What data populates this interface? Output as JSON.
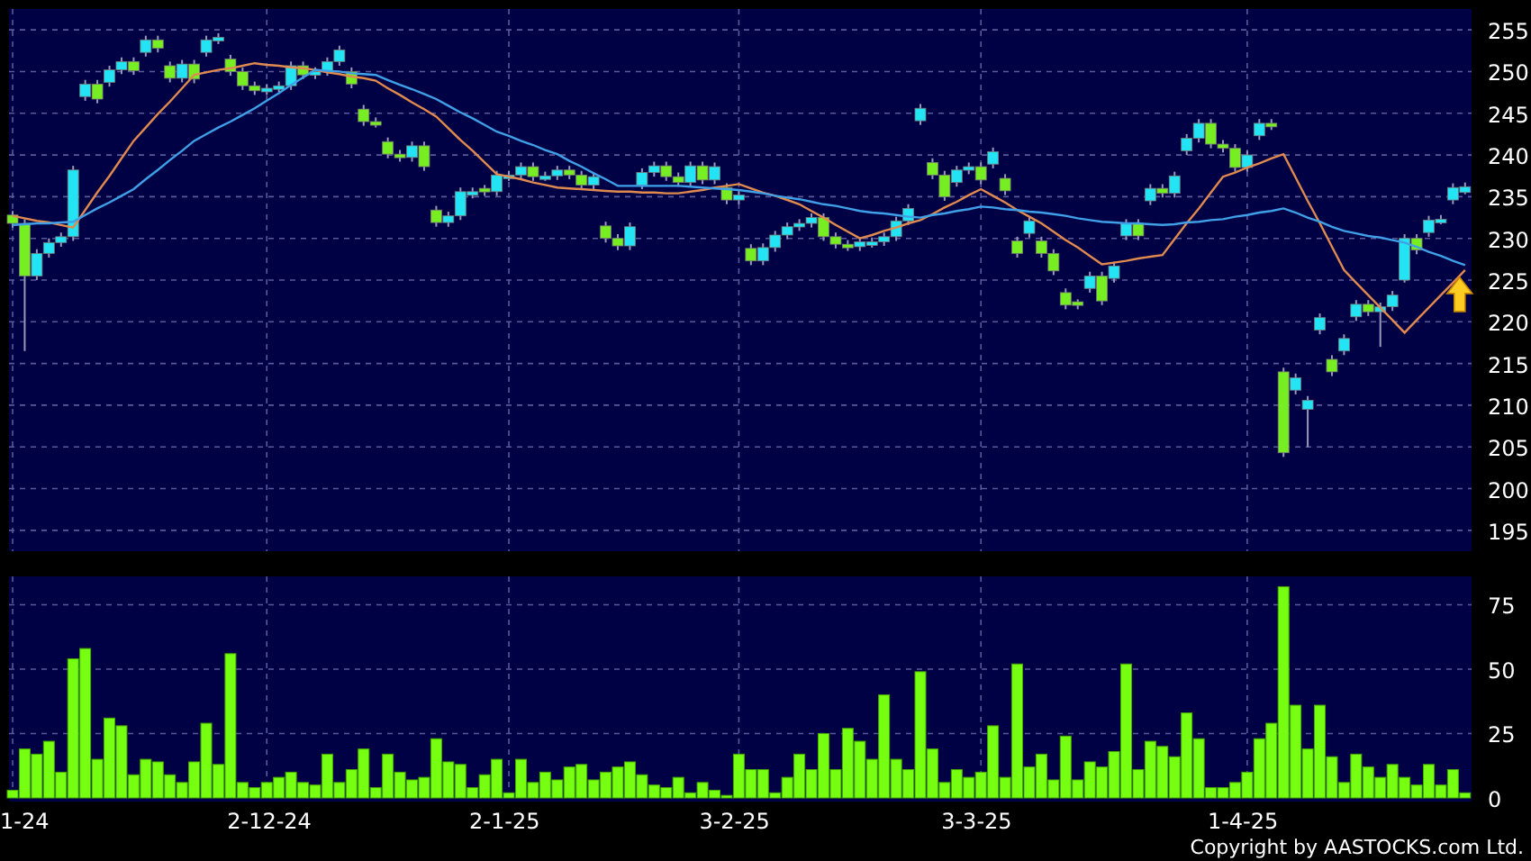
{
  "price_chart": {
    "chart_data": {
      "type": "candlestick",
      "grid": true,
      "ylim": [
        192.5,
        257.5
      ],
      "yticks": [
        195,
        200,
        205,
        210,
        215,
        220,
        225,
        230,
        235,
        240,
        245,
        250,
        255
      ],
      "ohlc": [
        [
          232.8,
          233.3,
          231.3,
          231.8
        ],
        [
          231.8,
          232.3,
          216.5,
          225.5
        ],
        [
          225.5,
          228.7,
          225,
          228.2
        ],
        [
          228.2,
          230,
          227.7,
          229.5
        ],
        [
          229.5,
          230.7,
          229,
          230.2
        ],
        [
          230.2,
          238.7,
          229.7,
          238.2
        ],
        [
          247,
          249,
          246.5,
          248.5
        ],
        [
          248.5,
          249,
          246.2,
          246.7
        ],
        [
          248.7,
          250.7,
          248.2,
          250.2
        ],
        [
          250.2,
          251.7,
          249.7,
          251.2
        ],
        [
          251.2,
          251.7,
          249.6,
          250.1
        ],
        [
          252.3,
          254.3,
          251.8,
          253.8
        ],
        [
          253.8,
          254.3,
          252.3,
          252.8
        ],
        [
          250.7,
          251.2,
          248.7,
          249.2
        ],
        [
          249.2,
          251.4,
          248.7,
          250.9
        ],
        [
          250.9,
          251.4,
          248.6,
          249.1
        ],
        [
          252.3,
          254.3,
          251.8,
          253.8
        ],
        [
          253.8,
          254.6,
          253.3,
          254.1
        ],
        [
          251.5,
          252,
          249.5,
          250
        ],
        [
          250,
          250.5,
          247.8,
          248.3
        ],
        [
          248.3,
          248.8,
          247.2,
          247.7
        ],
        [
          247.7,
          248.5,
          247.2,
          248
        ],
        [
          248,
          248.8,
          247.5,
          248.3
        ],
        [
          248.3,
          251.2,
          247.8,
          250.7
        ],
        [
          250.7,
          251.2,
          249.1,
          249.6
        ],
        [
          249.6,
          250.5,
          249.1,
          250
        ],
        [
          250,
          251.7,
          249.5,
          251.2
        ],
        [
          251.2,
          253.1,
          250.7,
          252.6
        ],
        [
          250,
          250.5,
          248,
          248.5
        ],
        [
          245.5,
          246,
          243.5,
          244
        ],
        [
          244,
          244.5,
          243.3,
          243.8
        ],
        [
          241.6,
          242.1,
          239.6,
          240.1
        ],
        [
          240.1,
          240.6,
          239.2,
          239.7
        ],
        [
          239.7,
          241.6,
          239.2,
          241.1
        ],
        [
          241.1,
          241.6,
          238.1,
          238.6
        ],
        [
          233.4,
          233.9,
          231.4,
          231.9
        ],
        [
          231.9,
          233.2,
          231.4,
          232.7
        ],
        [
          232.7,
          236.1,
          232.2,
          235.6
        ],
        [
          235.2,
          236.1,
          234.8,
          235.6
        ],
        [
          236,
          236.4,
          235.1,
          235.6
        ],
        [
          235.6,
          238.1,
          235.1,
          237.6
        ],
        [
          237.2,
          238.1,
          236.9,
          237.6
        ],
        [
          237.6,
          239.1,
          237.1,
          238.6
        ],
        [
          238.6,
          239.1,
          236.9,
          237.4
        ],
        [
          237.1,
          238,
          236.9,
          237.5
        ],
        [
          237.5,
          238.7,
          237,
          238.2
        ],
        [
          238.2,
          238.7,
          237.1,
          237.6
        ],
        [
          237.6,
          238.1,
          235.9,
          236.4
        ],
        [
          236.4,
          237.9,
          235.9,
          237.4
        ],
        [
          231.5,
          232,
          229.5,
          230
        ],
        [
          230,
          230.5,
          228.6,
          229.1
        ],
        [
          229.1,
          231.9,
          228.6,
          231.4
        ],
        [
          236.4,
          238.4,
          235.9,
          237.9
        ],
        [
          237.9,
          239.2,
          237.4,
          238.7
        ],
        [
          238.7,
          239.2,
          236.9,
          237.4
        ],
        [
          237.4,
          237.9,
          236.2,
          236.7
        ],
        [
          236.7,
          239.2,
          236.2,
          238.7
        ],
        [
          238.7,
          239.2,
          236.5,
          237
        ],
        [
          237,
          239.1,
          236.5,
          238.6
        ],
        [
          236.1,
          236.6,
          234.1,
          234.6
        ],
        [
          234.6,
          235.7,
          234.1,
          235.2
        ],
        [
          228.8,
          229.3,
          226.8,
          227.3
        ],
        [
          227.3,
          229.4,
          226.8,
          228.9
        ],
        [
          228.9,
          230.9,
          228.4,
          230.4
        ],
        [
          230.4,
          231.9,
          229.9,
          231.4
        ],
        [
          231.4,
          232.3,
          230.9,
          231.8
        ],
        [
          231.8,
          233,
          231.3,
          232.5
        ],
        [
          232.5,
          233,
          229.7,
          230.2
        ],
        [
          230.2,
          230.7,
          228.8,
          229.3
        ],
        [
          229.3,
          229.8,
          228.5,
          229
        ],
        [
          229,
          230.1,
          228.5,
          229.6
        ],
        [
          229.2,
          230.1,
          228.9,
          229.6
        ],
        [
          229.6,
          230.7,
          229.1,
          230.2
        ],
        [
          230.2,
          232.6,
          229.7,
          232.1
        ],
        [
          232.1,
          234.1,
          231.6,
          233.6
        ],
        [
          244.1,
          246.1,
          243.6,
          245.6
        ],
        [
          239.1,
          239.6,
          237.1,
          237.6
        ],
        [
          237.6,
          238.1,
          234.5,
          235
        ],
        [
          236.7,
          238.7,
          236.2,
          238.2
        ],
        [
          238.2,
          239.1,
          237.7,
          238.6
        ],
        [
          238.6,
          239.1,
          236.5,
          237
        ],
        [
          238.9,
          240.9,
          238.4,
          240.4
        ],
        [
          237.2,
          237.7,
          235.2,
          235.7
        ],
        [
          229.7,
          230.2,
          227.7,
          228.2
        ],
        [
          230.6,
          232.6,
          230.1,
          232.1
        ],
        [
          229.7,
          230.2,
          227.7,
          228.2
        ],
        [
          228.2,
          228.7,
          225.6,
          226.1
        ],
        [
          223.5,
          224,
          221.5,
          222
        ],
        [
          222.4,
          222.7,
          221.5,
          222
        ],
        [
          224,
          226,
          223.5,
          225.5
        ],
        [
          225.5,
          226,
          222,
          222.5
        ],
        [
          225.2,
          227.2,
          224.7,
          226.7
        ],
        [
          230.3,
          232.3,
          229.8,
          231.8
        ],
        [
          231.8,
          232.3,
          229.8,
          230.3
        ],
        [
          234.5,
          236.5,
          234,
          236
        ],
        [
          236,
          236.5,
          234.9,
          235.4
        ],
        [
          235.4,
          238,
          234.9,
          237.5
        ],
        [
          240.5,
          242.5,
          240,
          242
        ],
        [
          242,
          244.3,
          241.5,
          243.8
        ],
        [
          243.8,
          244.3,
          240.8,
          241.3
        ],
        [
          241.3,
          241.8,
          240.3,
          240.8
        ],
        [
          240.8,
          241.3,
          238,
          238.5
        ],
        [
          238.5,
          240.5,
          238,
          240
        ],
        [
          242.3,
          244.3,
          241.8,
          243.8
        ],
        [
          243.8,
          244.3,
          243,
          243.5
        ],
        [
          214,
          214.5,
          203.8,
          204.3
        ],
        [
          211.8,
          213.8,
          211.3,
          213.3
        ],
        [
          209.5,
          211.1,
          205,
          210.6
        ],
        [
          219,
          221,
          218.5,
          220.5
        ],
        [
          215.5,
          216,
          213.5,
          214
        ],
        [
          216.5,
          218.5,
          216,
          218
        ],
        [
          220.6,
          222.6,
          220.1,
          222.1
        ],
        [
          222.1,
          222.6,
          220.7,
          221.2
        ],
        [
          221.2,
          222.3,
          217,
          221.8
        ],
        [
          221.8,
          223.7,
          221.3,
          223.2
        ],
        [
          225,
          230.5,
          224.7,
          230
        ],
        [
          230,
          230.5,
          228.1,
          228.6
        ],
        [
          230.7,
          232.7,
          230.2,
          232.2
        ],
        [
          231.9,
          232.8,
          231.7,
          232.3
        ],
        [
          234.6,
          236.6,
          234.1,
          236.1
        ],
        [
          235.5,
          236.7,
          235.3,
          236.2
        ]
      ],
      "series": [
        {
          "type": "line",
          "color": "#e08a50",
          "values": [
            232.7,
            232.4,
            232.1,
            231.9,
            231.6,
            231.3,
            233.4,
            235.5,
            237.5,
            239.6,
            241.7,
            243.3,
            244.9,
            246.4,
            248,
            249.6,
            249.9,
            250.2,
            250.4,
            250.7,
            251,
            250.8,
            250.7,
            250.5,
            250.4,
            250.2,
            249.9,
            249.7,
            249.4,
            249.2,
            248.9,
            248,
            247.2,
            246.3,
            245.5,
            244.6,
            243.2,
            241.8,
            240.5,
            239.1,
            237.7,
            237.4,
            237.1,
            236.7,
            236.4,
            236.1,
            236,
            235.9,
            235.8,
            235.7,
            235.6,
            235.6,
            235.5,
            235.5,
            235.4,
            235.4,
            235.6,
            235.8,
            236.1,
            236.3,
            236.5,
            236,
            235.5,
            235.1,
            234.6,
            234.1,
            233.3,
            232.5,
            231.6,
            230.8,
            230,
            230.4,
            230.9,
            231.3,
            231.8,
            232.2,
            232.9,
            233.7,
            234.4,
            235.2,
            235.9,
            235.1,
            234.3,
            233.4,
            232.6,
            231.8,
            230.8,
            229.8,
            228.9,
            227.9,
            226.9,
            227.1,
            227.3,
            227.6,
            227.8,
            228,
            229.9,
            231.8,
            233.6,
            235.5,
            237.4,
            237.9,
            238.5,
            239,
            239.6,
            240.1,
            237.3,
            234.5,
            231.8,
            229,
            226.2,
            224.7,
            223.2,
            221.7,
            220.2,
            218.7,
            220.2,
            221.7,
            223.2,
            224.7,
            226.2
          ]
        },
        {
          "type": "line",
          "color": "#3fa0e8",
          "values": [
            231.6,
            231.7,
            231.8,
            231.8,
            231.9,
            232,
            232.8,
            233.6,
            234.3,
            235.1,
            235.9,
            237.1,
            238.2,
            239.4,
            240.5,
            241.7,
            242.5,
            243.3,
            244,
            244.8,
            245.6,
            246.5,
            247.4,
            248.4,
            249.3,
            250.2,
            250.1,
            250,
            249.8,
            249.7,
            249.6,
            249,
            248.4,
            247.9,
            247.3,
            246.7,
            245.9,
            245.1,
            244.4,
            243.6,
            242.8,
            242.3,
            241.7,
            241.2,
            240.6,
            240.1,
            239.3,
            238.6,
            237.8,
            237.1,
            236.3,
            236.3,
            236.3,
            236.3,
            236.3,
            236.3,
            236.2,
            236.1,
            236,
            235.9,
            235.8,
            235.6,
            235.4,
            235.1,
            234.9,
            234.7,
            234.4,
            234.1,
            233.9,
            233.6,
            233.3,
            233.1,
            233,
            232.8,
            232.6,
            232.5,
            232.8,
            233,
            233.3,
            233.5,
            233.8,
            233.7,
            233.5,
            233.4,
            233.2,
            233.1,
            232.9,
            232.7,
            232.4,
            232.2,
            232,
            231.9,
            231.8,
            231.8,
            231.7,
            231.6,
            231.7,
            231.9,
            232,
            232.2,
            232.3,
            232.6,
            232.8,
            233.1,
            233.3,
            233.6,
            233.1,
            232.5,
            232,
            231.4,
            230.9,
            230.6,
            230.3,
            230.1,
            229.8,
            229.5,
            229,
            228.4,
            227.9,
            227.3,
            226.8
          ]
        }
      ]
    }
  },
  "volume_chart": {
    "chart_data": {
      "type": "bar",
      "grid": true,
      "ylim": [
        0,
        86
      ],
      "yticks": [
        0,
        25,
        50,
        75
      ],
      "values": [
        3,
        19,
        17,
        22,
        10,
        54,
        58,
        15,
        31,
        28,
        9,
        15,
        14,
        9,
        6,
        14,
        29,
        13,
        56,
        6,
        4,
        6,
        8,
        10,
        6,
        5,
        17,
        6,
        11,
        19,
        4,
        17,
        10,
        7,
        8,
        23,
        14,
        13,
        4,
        9,
        15,
        2,
        15,
        6,
        10,
        7,
        12,
        13,
        7,
        10,
        12,
        14,
        9,
        5,
        4,
        8,
        2,
        6,
        3,
        1,
        17,
        11,
        11,
        2,
        8,
        17,
        11,
        25,
        11,
        27,
        22,
        15,
        40,
        15,
        11,
        49,
        19,
        6,
        11,
        8,
        10,
        28,
        8,
        52,
        12,
        17,
        7,
        24,
        7,
        14,
        12,
        18,
        52,
        11,
        22,
        20,
        16,
        33,
        23,
        4,
        4,
        6,
        10,
        23,
        29,
        82,
        36,
        19,
        36,
        16,
        6,
        17,
        12,
        8,
        13,
        8,
        5,
        13,
        5,
        11,
        2
      ]
    },
    "date_labels": [
      "1-24",
      "2-12-24",
      "2-1-25",
      "3-2-25",
      "3-3-25",
      "1-4-25"
    ]
  },
  "copyright": "Copyright by AASTOCKS.com Ltd."
}
